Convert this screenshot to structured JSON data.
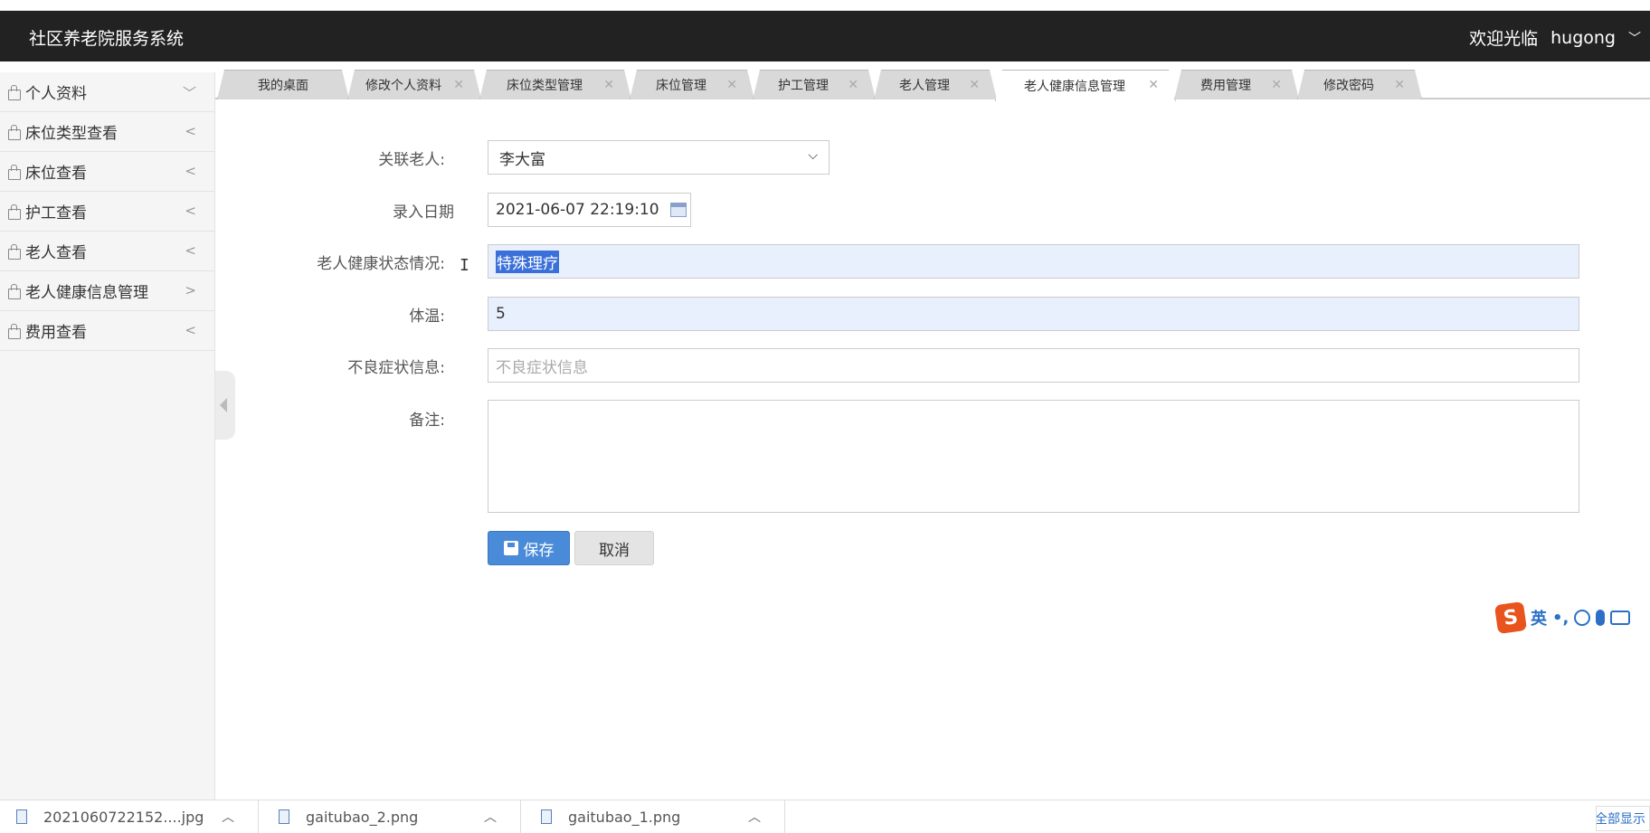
{
  "header": {
    "title": "社区养老院服务系统",
    "welcome_label": "欢迎光临",
    "username": "hugong"
  },
  "sidebar": {
    "items": [
      {
        "label": "个人资料",
        "arrow": "﹀"
      },
      {
        "label": "床位类型查看",
        "arrow": "<"
      },
      {
        "label": "床位查看",
        "arrow": "<"
      },
      {
        "label": "护工查看",
        "arrow": "<"
      },
      {
        "label": "老人查看",
        "arrow": "<"
      },
      {
        "label": "老人健康信息管理",
        "arrow": ">"
      },
      {
        "label": "费用查看",
        "arrow": "<"
      }
    ]
  },
  "tabs": [
    {
      "label": "我的桌面"
    },
    {
      "label": "修改个人资料"
    },
    {
      "label": "床位类型管理"
    },
    {
      "label": "床位管理"
    },
    {
      "label": "护工管理"
    },
    {
      "label": "老人管理"
    },
    {
      "label": "老人健康信息管理"
    },
    {
      "label": "费用管理"
    },
    {
      "label": "修改密码"
    }
  ],
  "form": {
    "elder_label": "关联老人:",
    "elder_value": "李大富",
    "date_label": "录入日期",
    "date_value": "2021-06-07 22:19:10",
    "health_label": "老人健康状态情况:",
    "health_value": "特殊理疗",
    "temp_label": "体温:",
    "temp_value": "5",
    "symptom_label": "不良症状信息:",
    "symptom_placeholder": "不良症状信息",
    "remark_label": "备注:",
    "remark_value": "",
    "save_label": "保存",
    "cancel_label": "取消"
  },
  "ime": {
    "mode": "英",
    "punct": "•,"
  },
  "downloads": {
    "items": [
      {
        "name": "2021060722152....jpg"
      },
      {
        "name": "gaitubao_2.png"
      },
      {
        "name": "gaitubao_1.png"
      }
    ],
    "show_all": "全部显示"
  },
  "colors": {
    "header_bg": "#222222",
    "save_button": "#4a8bd9",
    "autofill_bg": "#e8f0fe",
    "selection": "#3b70d8"
  }
}
